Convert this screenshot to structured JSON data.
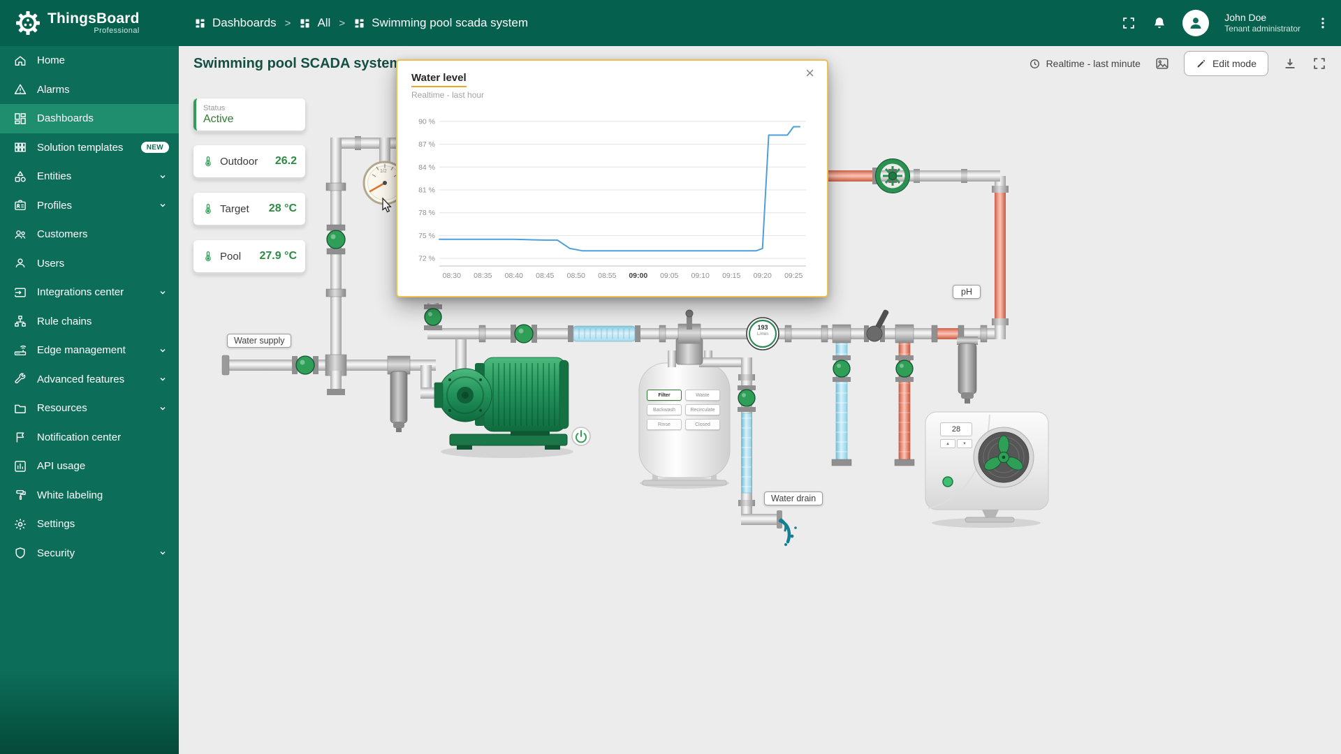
{
  "header": {
    "brand": "ThingsBoard",
    "brand_sub": "Professional",
    "breadcrumb": [
      {
        "label": "Dashboards",
        "icon": "dashboards-icon"
      },
      {
        "label": "All",
        "icon": "dashboards-icon"
      },
      {
        "label": "Swimming pool scada system",
        "icon": "dashboards-icon"
      }
    ],
    "breadcrumb_separator": ">",
    "user_name": "John Doe",
    "user_role": "Tenant administrator",
    "icons": [
      "fullscreen-icon",
      "notifications-icon",
      "avatar",
      "more-menu-icon"
    ]
  },
  "sidebar": {
    "items": [
      {
        "label": "Home",
        "icon": "home-icon"
      },
      {
        "label": "Alarms",
        "icon": "alarms-icon"
      },
      {
        "label": "Dashboards",
        "icon": "dashboards-icon",
        "active": true
      },
      {
        "label": "Solution templates",
        "icon": "solution-templates-icon",
        "badge": "NEW"
      },
      {
        "label": "Entities",
        "icon": "entities-icon",
        "expandable": true
      },
      {
        "label": "Profiles",
        "icon": "profiles-icon",
        "expandable": true
      },
      {
        "label": "Customers",
        "icon": "customers-icon"
      },
      {
        "label": "Users",
        "icon": "users-icon"
      },
      {
        "label": "Integrations center",
        "icon": "integrations-icon",
        "expandable": true
      },
      {
        "label": "Rule chains",
        "icon": "rule-chains-icon"
      },
      {
        "label": "Edge management",
        "icon": "edge-management-icon",
        "expandable": true
      },
      {
        "label": "Advanced features",
        "icon": "advanced-features-icon",
        "expandable": true
      },
      {
        "label": "Resources",
        "icon": "resources-icon",
        "expandable": true
      },
      {
        "label": "Notification center",
        "icon": "notification-center-icon"
      },
      {
        "label": "API usage",
        "icon": "api-usage-icon"
      },
      {
        "label": "White labeling",
        "icon": "white-labeling-icon"
      },
      {
        "label": "Settings",
        "icon": "settings-icon"
      },
      {
        "label": "Security",
        "icon": "security-icon",
        "expandable": true
      }
    ]
  },
  "toolbar": {
    "title": "Swimming pool SCADA system",
    "timewindow": "Realtime - last minute",
    "timewindow_icon": "clock-icon",
    "edit_button": "Edit mode",
    "icons": [
      "image-icon",
      "edit-pencil-icon",
      "download-icon",
      "fullscreen-icon"
    ]
  },
  "widgets": {
    "status": {
      "label": "Status",
      "value": "Active"
    },
    "temperatures": [
      {
        "label": "Outdoor",
        "value": "26.2",
        "icon": "thermometer-icon"
      },
      {
        "label": "Target",
        "value": "28 °C",
        "icon": "thermometer-icon"
      },
      {
        "label": "Pool",
        "value": "27.9 °C",
        "icon": "thermometer-icon"
      }
    ]
  },
  "scada": {
    "water_supply_label": "Water supply",
    "water_drain_label": "Water drain",
    "ph_label": "pH",
    "gauge_label": "1/2",
    "flow_meter": {
      "value": "193",
      "unit": "L/min"
    },
    "filter_valve_buttons": [
      {
        "label": "Filter",
        "selected": true
      },
      {
        "label": "Waste",
        "selected": false
      },
      {
        "label": "Backwash",
        "selected": false
      },
      {
        "label": "Recirculate",
        "selected": false
      },
      {
        "label": "Rinse",
        "selected": false
      },
      {
        "label": "Closed",
        "selected": false
      }
    ],
    "heat_pump": {
      "display": "28",
      "up_icon": "▲",
      "down_icon": "▼"
    }
  },
  "modal": {
    "title": "Water level",
    "subtitle": "Realtime - last hour",
    "close_icon": "×"
  },
  "chart_data": {
    "type": "line",
    "title": "Water level",
    "subtitle": "Realtime - last hour",
    "grid": "horizontal",
    "legend": false,
    "xlim": [
      "08:28",
      "09:27"
    ],
    "ylim": [
      71,
      91
    ],
    "y_unit": "%",
    "y_ticks": [
      {
        "value": 72,
        "label": "72 %"
      },
      {
        "value": 75,
        "label": "75 %"
      },
      {
        "value": 78,
        "label": "78 %"
      },
      {
        "value": 81,
        "label": "81 %"
      },
      {
        "value": 84,
        "label": "84 %"
      },
      {
        "value": 87,
        "label": "87 %"
      },
      {
        "value": 90,
        "label": "90 %"
      }
    ],
    "x_ticks": [
      {
        "label": "08:30",
        "bold": false
      },
      {
        "label": "08:35",
        "bold": false
      },
      {
        "label": "08:40",
        "bold": false
      },
      {
        "label": "08:45",
        "bold": false
      },
      {
        "label": "08:50",
        "bold": false
      },
      {
        "label": "08:55",
        "bold": false
      },
      {
        "label": "09:00",
        "bold": true
      },
      {
        "label": "09:05",
        "bold": false
      },
      {
        "label": "09:10",
        "bold": false
      },
      {
        "label": "09:15",
        "bold": false
      },
      {
        "label": "09:20",
        "bold": false
      },
      {
        "label": "09:25",
        "bold": false
      }
    ],
    "series": [
      {
        "name": "Water level",
        "color": "#4d9fdb",
        "points": [
          [
            "08:28",
            74.5
          ],
          [
            "08:35",
            74.5
          ],
          [
            "08:40",
            74.5
          ],
          [
            "08:45",
            74.4
          ],
          [
            "08:47",
            74.4
          ],
          [
            "08:49",
            73.3
          ],
          [
            "08:51",
            73.0
          ],
          [
            "09:00",
            73.0
          ],
          [
            "09:10",
            73.0
          ],
          [
            "09:19",
            73.0
          ],
          [
            "09:20",
            73.3
          ],
          [
            "09:21",
            88.2
          ],
          [
            "09:24",
            88.2
          ],
          [
            "09:25",
            89.3
          ],
          [
            "09:26",
            89.3
          ]
        ]
      }
    ]
  }
}
